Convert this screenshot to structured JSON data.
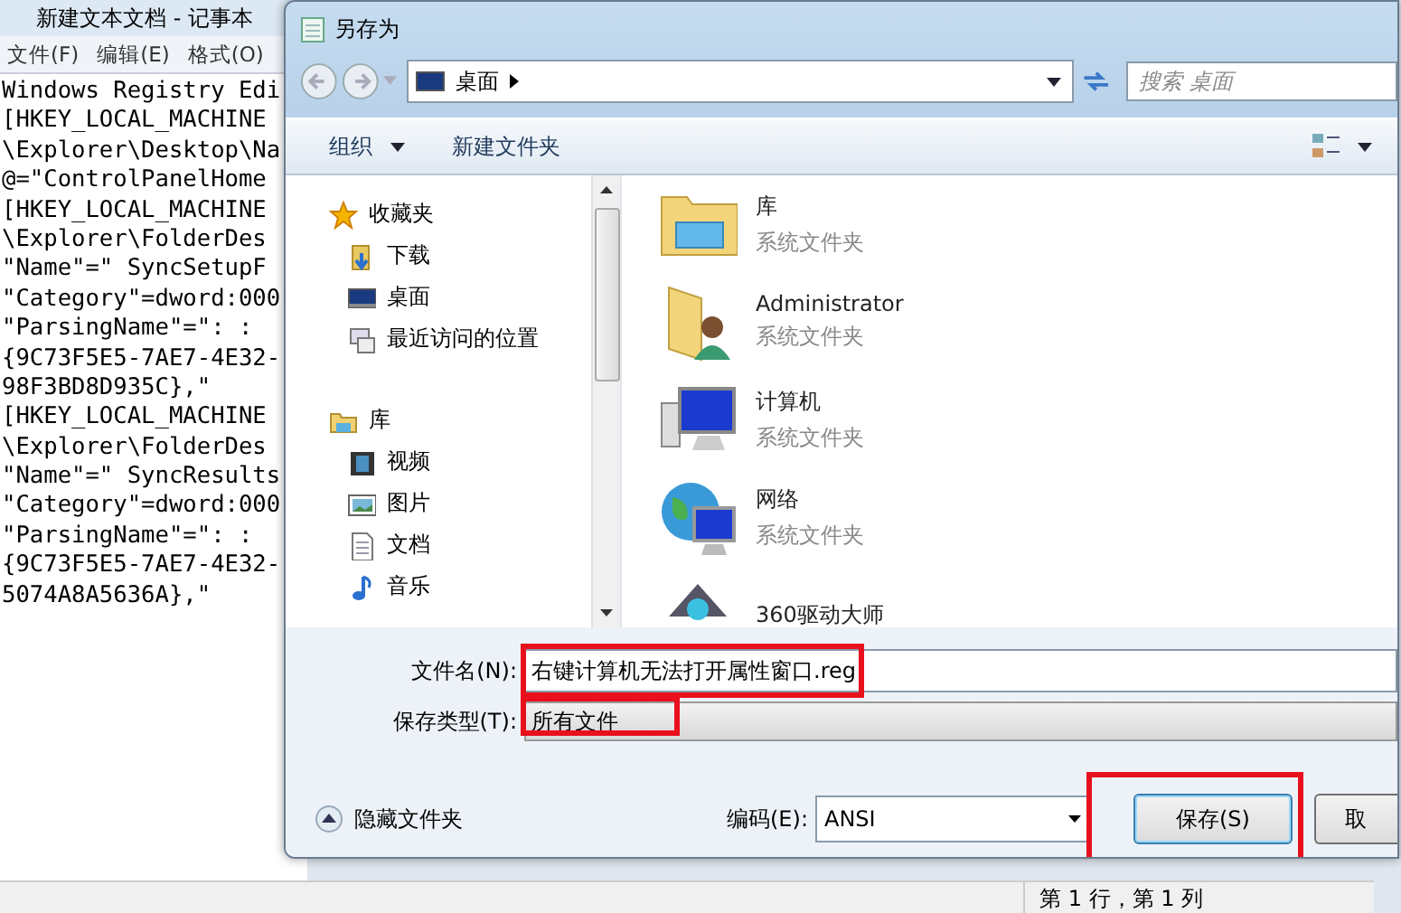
{
  "notepad": {
    "title": "新建文本文档 - 记事本",
    "menu": [
      "文件(F)",
      "编辑(E)",
      "格式(O)"
    ],
    "lines": [
      "Windows Registry Edi",
      "[HKEY_LOCAL_MACHINE",
      "\\Explorer\\Desktop\\Na",
      "@=\"ControlPanelHome",
      "[HKEY_LOCAL_MACHINE",
      "\\Explorer\\FolderDes",
      "\"Name\"=\" SyncSetupF",
      "\"Category\"=dword:000",
      "\"ParsingName\"=\": :",
      "{9C73F5E5-7AE7-4E32-",
      "98F3BD8D935C},\"",
      "[HKEY_LOCAL_MACHINE",
      "\\Explorer\\FolderDes",
      "\"Name\"=\" SyncResults",
      "\"Category\"=dword:000",
      "\"ParsingName\"=\": :",
      "{9C73F5E5-7AE7-4E32-",
      "5074A8A5636A},\""
    ],
    "status_bar": "第 1 行，第 1 列"
  },
  "dialog": {
    "title": "另存为",
    "location": "桌面",
    "search": {
      "placeholder": "搜索 桌面"
    },
    "toolbar": [
      "组织",
      "新建文件夹"
    ],
    "sidebar": [
      {
        "label": "收藏夹",
        "kind": "star",
        "children": [
          {
            "label": "下载",
            "kind": "download"
          },
          {
            "label": "桌面",
            "kind": "desktop"
          },
          {
            "label": "最近访问的位置",
            "kind": "recent"
          }
        ]
      },
      {
        "label": "库",
        "kind": "library",
        "children": [
          {
            "label": "视频",
            "kind": "video"
          },
          {
            "label": "图片",
            "kind": "picture"
          },
          {
            "label": "文档",
            "kind": "document"
          },
          {
            "label": "音乐",
            "kind": "music"
          }
        ]
      }
    ],
    "items": [
      {
        "name": "库",
        "subtitle": "系统文件夹",
        "kind": "library"
      },
      {
        "name": "Administrator",
        "subtitle": "系统文件夹",
        "kind": "user"
      },
      {
        "name": "计算机",
        "subtitle": "系统文件夹",
        "kind": "computer"
      },
      {
        "name": "网络",
        "subtitle": "系统文件夹",
        "kind": "network"
      },
      {
        "name": "360驱动大师",
        "kind": "app"
      }
    ],
    "filename": {
      "label": "文件名(N):",
      "value": "右键计算机无法打开属性窗口.reg",
      "highlighted": true
    },
    "filetype": {
      "label": "保存类型(T):",
      "value": "所有文件",
      "highlighted": true
    },
    "hide_folders": "隐藏文件夹",
    "encoding": {
      "label": "编码(E):",
      "value": "ANSI"
    },
    "buttons": [
      {
        "label": "保存(S)",
        "highlighted": true,
        "default": true
      },
      {
        "label": "取",
        "highlighted": false,
        "default": false
      }
    ]
  }
}
